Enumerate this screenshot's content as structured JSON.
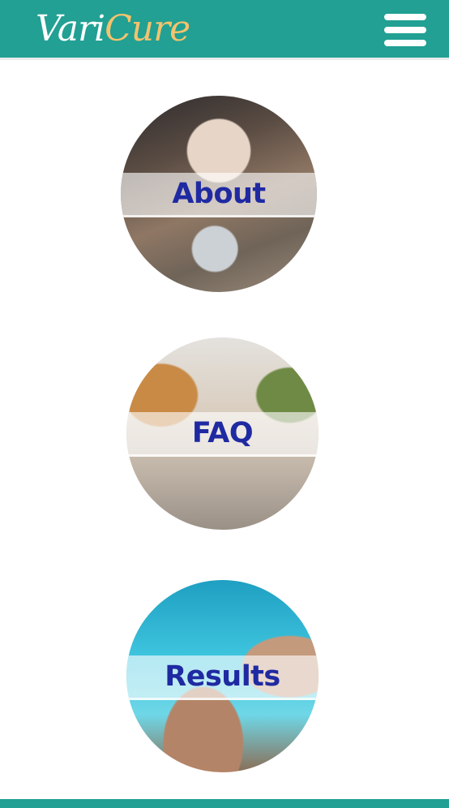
{
  "header": {
    "logo_part1": "Vari",
    "logo_part2": "Cure",
    "brand_color": "#21a093",
    "logo_accent_color": "#f3c36d",
    "menu_icon": "hamburger-menu-icon"
  },
  "tiles": [
    {
      "label": "About",
      "image": "sneaker-lacing-photo"
    },
    {
      "label": "FAQ",
      "image": "legs-heels-photo"
    },
    {
      "label": "Results",
      "image": "poolside-legs-photo"
    }
  ],
  "colors": {
    "label_text": "#1f2aa2",
    "footer": "#21a093"
  }
}
